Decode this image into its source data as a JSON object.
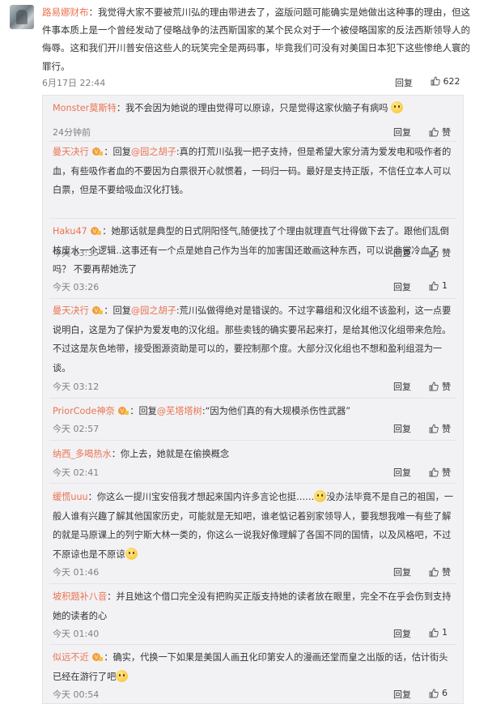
{
  "main_comment": {
    "username": "路易娜财布",
    "text": "：我觉得大家不要被荒川弘的理由带进去了，盗版问题可能确实是她做出这种事的理由，但这件事本质上是一个曾经发动了侵略战争的法西斯国家的某个民众对于一个被侵略国家的反法西斯领导人的侮辱。这和我们开川普安倍这些人的玩笑完全是两码事，毕竟我们可没有对美国日本犯下这些惨绝人寰的罪行。",
    "time": "6月17日 22:44",
    "reply_label": "回复",
    "likes": "622"
  },
  "replies": [
    {
      "username": "Monster莫斯特",
      "text": "：我不会因为她说的理由觉得可以原谅，只是觉得这家伙脑子有病吗",
      "emoji": true,
      "time": "24分钟前",
      "reply_label": "回复",
      "likes": "赞"
    },
    {
      "username": "曼天决行",
      "vip": true,
      "mention": "@园之胡子",
      "prefix": "：回复",
      "text": ":真的打荒川弘我一把子支持，但是希望大家分清为爱发电和吸作者的血，有些吸作者血的不要因为白票很开心就惯着，一码归一码。最好是支持正版，不信任立本人可以白票，但是不要给吸血汉化打钱。",
      "time": "今天 03:35",
      "reply_label": "回复",
      "likes": "赞"
    },
    {
      "username": "Haku47",
      "vip": true,
      "text": "：她那话就是典型的日式阴阳怪气,随便找了个理由就理直气壮得做下去了。跟他们乱倒核废水一个逻辑..这事还有一个点是她自己作为当年的加害国还敢画这种东西，可以说非常冷血了吗？ 不要再帮她洗了",
      "time": "今天 03:26",
      "reply_label": "回复",
      "likes": "1"
    },
    {
      "username": "曼天决行",
      "vip": true,
      "mention": "@园之胡子",
      "prefix": "：回复",
      "text": ":荒川弘做得绝对是错误的。不过字幕组和汉化组不该盈利，这一点要说明白，这是为了保护为爱发电的汉化组。那些卖钱的确实要吊起来打，是给其他汉化组带来危险。不过这是灰色地带，接受图源资助是可以的，要控制那个度。大部分汉化组也不想和盈利组混为一谈。",
      "time": "今天 03:12",
      "reply_label": "回复",
      "likes": "赞"
    },
    {
      "username": "PriorCode神奈",
      "vip": true,
      "mention": "@芜塔塔树",
      "prefix": "：回复",
      "text": ":“因为他们真的有大规模杀伤性武器”",
      "time": "今天 02:57",
      "reply_label": "回复",
      "likes": "赞"
    },
    {
      "username": "纳西_多喝热水",
      "text": "：你上去，她就是在偷换概念",
      "time": "今天 02:41",
      "reply_label": "回复",
      "likes": "赞"
    },
    {
      "username": "缓慌uuu",
      "text": "：你这么一提川宝安倍我才想起来国内许多言论也挺……",
      "emoji_mid": true,
      "text2": "没办法毕竟不是自己的祖国，一般人谁有兴趣了解其他国家历史，可能就是无知吧，谁老惦记着别家领导人，要我想我唯一有些了解的就是马原课上的列宁斯大林一类的，你这么一说我好像理解了各国不同的国情，以及风格吧，不过不原谅也是不原谅",
      "emoji": true,
      "time": "今天 01:46",
      "reply_label": "回复",
      "likes": "赞"
    },
    {
      "username": "坡积题补八音",
      "text": "：并且她这个借口完全没有把购买正版支持她的读者放在眼里，完全不在乎会伤到支持她的读者的心",
      "time": "今天 01:40",
      "reply_label": "回复",
      "likes": "1"
    },
    {
      "username": "似远不近",
      "vip": true,
      "text": "：确实，代换一下如果是美国人画丑化印第安人的漫画还堂而皇之出版的话，估计街头已经在游行了吧",
      "emoji": true,
      "time": "今天 00:54",
      "reply_label": "回复",
      "likes": "6"
    }
  ]
}
